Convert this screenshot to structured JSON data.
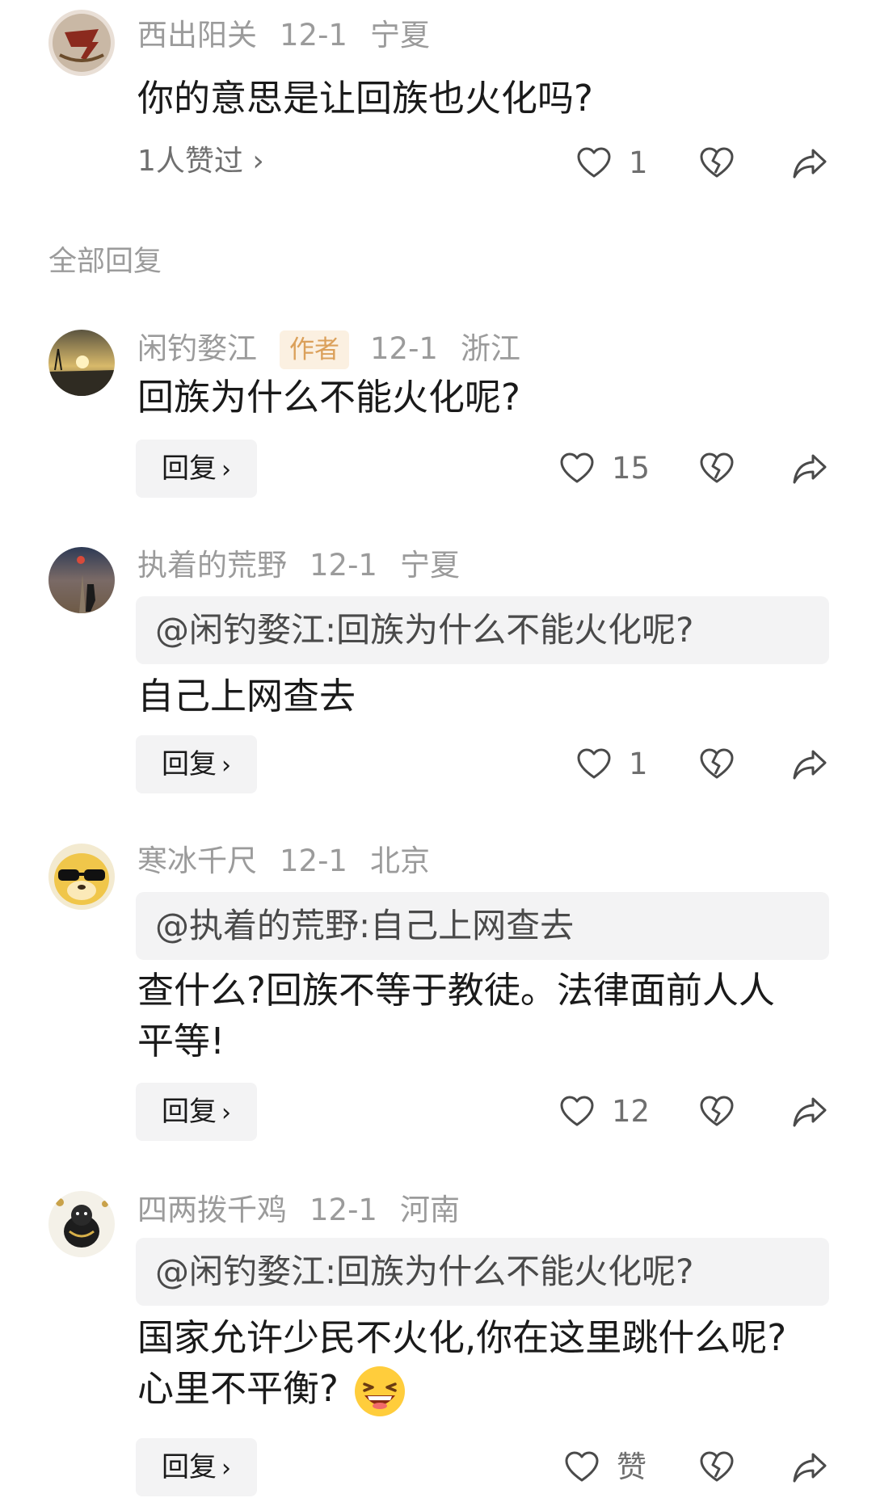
{
  "top_comment": {
    "username": "西出阳关",
    "date": "12-1",
    "location": "宁夏",
    "text": "你的意思是让回族也火化吗?",
    "liked_by": "1人赞过 ›",
    "like_count": "1"
  },
  "section_title": "全部回复",
  "replies": [
    {
      "username": "闲钓婺江",
      "author_tag": "作者",
      "date": "12-1",
      "location": "浙江",
      "text": "回族为什么不能火化呢?",
      "reply_label": "回复",
      "like_count": "15"
    },
    {
      "username": "执着的荒野",
      "date": "12-1",
      "location": "宁夏",
      "quote": "@闲钓婺江:回族为什么不能火化呢?",
      "text": "自己上网查去",
      "reply_label": "回复",
      "like_count": "1"
    },
    {
      "username": "寒冰千尺",
      "date": "12-1",
      "location": "北京",
      "quote": "@执着的荒野:自己上网查去",
      "text": "查什么?回族不等于教徒。法律面前人人平等!",
      "reply_label": "回复",
      "like_count": "12"
    },
    {
      "username": "四两拨千鸡",
      "date": "12-1",
      "location": "河南",
      "quote": "@闲钓婺江:回族为什么不能火化呢?",
      "text": "国家允许少民不火化,你在这里跳什么呢?心里不平衡?",
      "reply_label": "回复",
      "like_count": "赞"
    }
  ],
  "icons": {
    "like": "heart-outline-icon",
    "dislike": "broken-heart-icon",
    "share": "share-arrow-icon",
    "emoji": "grinning-squint-emoji"
  },
  "colors": {
    "author_tag_bg": "#fbf0e1",
    "author_tag_text": "#dba05a",
    "meta_gray": "#9b9b9b",
    "quote_bg": "#f3f3f4"
  }
}
